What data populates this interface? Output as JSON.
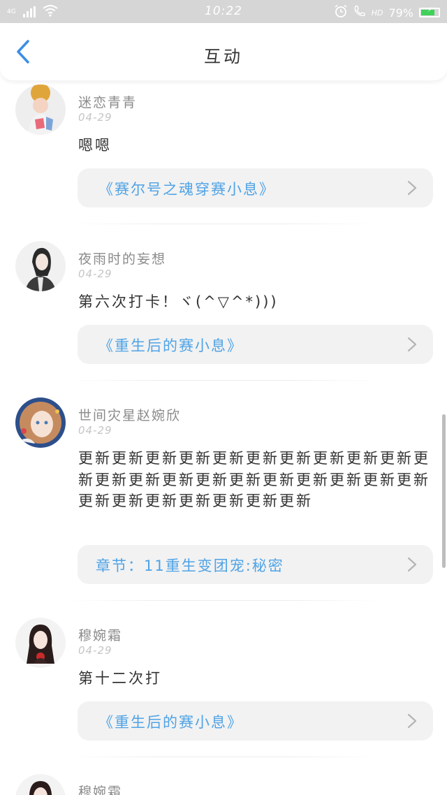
{
  "status_bar": {
    "network": "4G",
    "time": "10:22",
    "hd": "HD",
    "battery": "79%",
    "battery_level": 0.79
  },
  "header": {
    "title": "互动"
  },
  "posts": [
    {
      "username": "迷恋青青",
      "date": "04-29",
      "content": "嗯嗯",
      "link": "《赛尔号之魂穿赛小息》"
    },
    {
      "username": "夜雨时的妄想",
      "date": "04-29",
      "content": "第六次打卡！ヾ(^▽^*)))",
      "link": "《重生后的赛小息》"
    },
    {
      "username": "世间灾星赵婉欣",
      "date": "04-29",
      "content": "更新更新更新更新更新更新更新更新更新更新更新更新更新更新更新更新更新更新更新更新更新更新更新更新更新更新更新更新",
      "link": "章节：11重生变团宠:秘密"
    },
    {
      "username": "穆婉霜",
      "date": "04-29",
      "content": "第十二次打",
      "link": "《重生后的赛小息》"
    },
    {
      "username": "穆婉霜"
    }
  ],
  "icons": {
    "back": "chevron-left-icon",
    "link": "chevron-right-icon"
  },
  "colors": {
    "accent": "#4fa3e6",
    "status_bar": "#d6d6d6",
    "battery": "#3fd15a"
  }
}
